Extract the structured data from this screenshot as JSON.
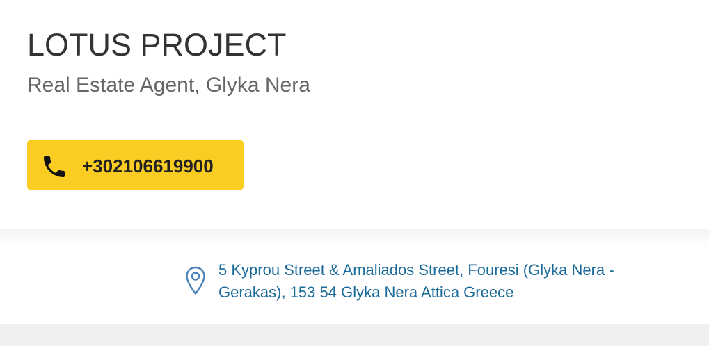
{
  "business": {
    "name": "LOTUS PROJECT",
    "category_location": "Real Estate Agent, Glyka Nera"
  },
  "phone_button": {
    "number": "+302106619900",
    "icon": "phone-icon",
    "color": "#fbcc22"
  },
  "address": {
    "text": "5 Kyprou Street & Amaliados Street, Fouresi (Glyka Nera - Gerakas), 153 54 Glyka Nera Attica Greece",
    "icon": "map-pin-icon",
    "color": "#1a6a9a"
  }
}
